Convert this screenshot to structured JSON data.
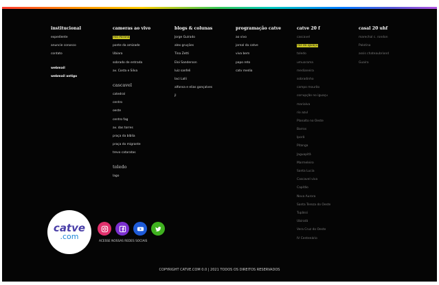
{
  "columns": {
    "institucional": {
      "title": "institucional",
      "items": [
        "expediente",
        "anuncie conosco",
        "contato"
      ],
      "extra": [
        "webmail",
        "webmail antigo"
      ]
    },
    "cameras": {
      "title": "cameras ao vivo",
      "items": [
        "Rio Paraná",
        "ponte da amizade",
        "Ubiara",
        "sobrado de entrada",
        "av. Costa e Silva"
      ],
      "sub1_title": "cascavel",
      "sub1_items": [
        "catedral",
        "centro",
        "oeste",
        "centro fag",
        "av. das torres",
        "praça da bíblia",
        "praça do migrante",
        "trevo cataratas"
      ],
      "sub2_title": "toledo",
      "sub2_items": [
        "lago"
      ]
    },
    "blogs": {
      "title": "blogs & colunas",
      "items": [
        "Jorge Guirado",
        "alex gruções",
        "Tina Zetti",
        "Eloi Sanderson",
        "luiz sanfeli",
        "Iaci Lalli",
        "alfonsa e elias gonçalves",
        "jl"
      ]
    },
    "programacao": {
      "title": "programação catve",
      "items": [
        "ao vivo",
        "jornal da catve",
        "viva bem",
        "papo reto",
        "catv media"
      ]
    },
    "catve": {
      "title": "catve 20 f",
      "items": [
        "cascavel",
        "foz do iguaçu",
        "toledo",
        "umuarama",
        "medianeira",
        "sobradinho",
        "campo mourão",
        "corrupção no iguaçu",
        "marialva",
        "rio azul",
        "Planalto no Oeste",
        "Barros",
        "Iporã",
        "Pitanga",
        "Jaguapitã",
        "Marmeleiro",
        "Santa Lucia",
        "Cascavel viva",
        "Capitão",
        "Nova Aurora",
        "Santa Tereza do Oeste",
        "Tupãssi",
        "Ubiratã",
        "Vera Cruz do Oeste",
        "IV Centenário"
      ]
    },
    "casal": {
      "title": "casal 20 uhf",
      "items": [
        "marechal c. rondon",
        "Palotina",
        "assis chateaubriand",
        "Guaíra"
      ]
    }
  },
  "social": {
    "label": "ACESSE NOSSAS REDES SOCIAIS",
    "icons": [
      {
        "name": "instagram-icon",
        "color": "#e1306c"
      },
      {
        "name": "facebook-icon",
        "color": "#7b2fd0"
      },
      {
        "name": "youtube-icon",
        "color": "#1e5bd8"
      },
      {
        "name": "twitter-icon",
        "color": "#3fb11f"
      }
    ]
  },
  "logo": {
    "line1": "catve",
    "line2": ".com"
  },
  "copyright": "COPYRIGHT CATVE.COM 0.0 | 2021 TODOS OS DIREITOS RESERVADOS"
}
